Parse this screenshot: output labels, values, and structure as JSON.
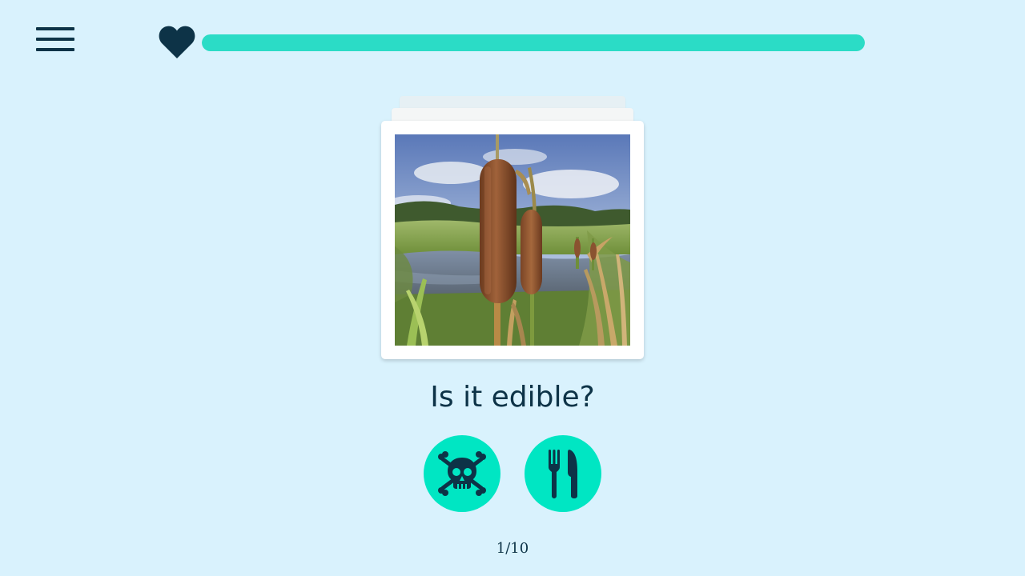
{
  "header": {
    "menu_icon": "hamburger-menu-icon",
    "lives_icon": "heart-icon",
    "progress_fraction": 1.0,
    "colors": {
      "background": "#d9f2fd",
      "progress": "#2bdcc6",
      "ink": "#0d3347"
    }
  },
  "card": {
    "image_subject": "cattail plant in a pond",
    "stack_depth": 3
  },
  "question": {
    "text": "Is it edible?"
  },
  "answers": [
    {
      "name": "poisonous",
      "icon": "skull-crossbones-icon"
    },
    {
      "name": "edible",
      "icon": "fork-knife-icon"
    }
  ],
  "answer_color": "#00e6c3",
  "progress_counter": "1/10"
}
